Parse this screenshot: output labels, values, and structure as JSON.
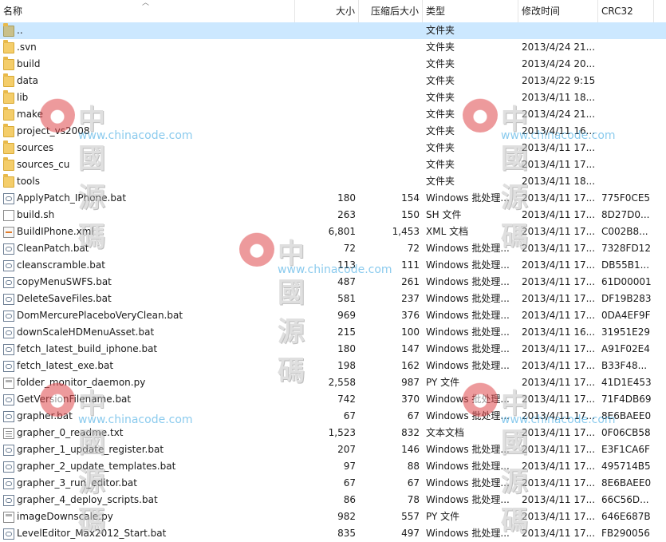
{
  "columns": {
    "name": "名称",
    "size": "大小",
    "compressed": "压缩后大小",
    "type": "类型",
    "modified": "修改时间",
    "crc": "CRC32"
  },
  "files": [
    {
      "name": "..",
      "size": "",
      "compressed": "",
      "type": "文件夹",
      "modified": "",
      "crc": "",
      "icon": "folder-up-icon",
      "selected": true
    },
    {
      "name": ".svn",
      "size": "",
      "compressed": "",
      "type": "文件夹",
      "modified": "2013/4/24 21...",
      "crc": "",
      "icon": "folder-icon"
    },
    {
      "name": "build",
      "size": "",
      "compressed": "",
      "type": "文件夹",
      "modified": "2013/4/24 20...",
      "crc": "",
      "icon": "folder-icon"
    },
    {
      "name": "data",
      "size": "",
      "compressed": "",
      "type": "文件夹",
      "modified": "2013/4/22 9:15",
      "crc": "",
      "icon": "folder-icon"
    },
    {
      "name": "lib",
      "size": "",
      "compressed": "",
      "type": "文件夹",
      "modified": "2013/4/11 18...",
      "crc": "",
      "icon": "folder-icon"
    },
    {
      "name": "make",
      "size": "",
      "compressed": "",
      "type": "文件夹",
      "modified": "2013/4/24 21...",
      "crc": "",
      "icon": "folder-icon"
    },
    {
      "name": "project_vs2008",
      "size": "",
      "compressed": "",
      "type": "文件夹",
      "modified": "2013/4/11 16...",
      "crc": "",
      "icon": "folder-icon"
    },
    {
      "name": "sources",
      "size": "",
      "compressed": "",
      "type": "文件夹",
      "modified": "2013/4/11 17...",
      "crc": "",
      "icon": "folder-icon"
    },
    {
      "name": "sources_cu",
      "size": "",
      "compressed": "",
      "type": "文件夹",
      "modified": "2013/4/11 17...",
      "crc": "",
      "icon": "folder-icon"
    },
    {
      "name": "tools",
      "size": "",
      "compressed": "",
      "type": "文件夹",
      "modified": "2013/4/11 18...",
      "crc": "",
      "icon": "folder-icon"
    },
    {
      "name": "ApplyPatch_IPhone.bat",
      "size": "180",
      "compressed": "154",
      "type": "Windows 批处理...",
      "modified": "2013/4/11 17...",
      "crc": "775F0CE5",
      "icon": "batch-file-icon"
    },
    {
      "name": "build.sh",
      "size": "263",
      "compressed": "150",
      "type": "SH 文件",
      "modified": "2013/4/11 17...",
      "crc": "8D27D0...",
      "icon": "document-icon"
    },
    {
      "name": "BuildIPhone.xml",
      "size": "6,801",
      "compressed": "1,453",
      "type": "XML 文档",
      "modified": "2013/4/11 17...",
      "crc": "C002B8...",
      "icon": "xml-file-icon"
    },
    {
      "name": "CleanPatch.bat",
      "size": "72",
      "compressed": "72",
      "type": "Windows 批处理...",
      "modified": "2013/4/11 17...",
      "crc": "7328FD12",
      "icon": "batch-file-icon"
    },
    {
      "name": "cleanscramble.bat",
      "size": "113",
      "compressed": "111",
      "type": "Windows 批处理...",
      "modified": "2013/4/11 17...",
      "crc": "DB55B1...",
      "icon": "batch-file-icon"
    },
    {
      "name": "copyMenuSWFS.bat",
      "size": "487",
      "compressed": "261",
      "type": "Windows 批处理...",
      "modified": "2013/4/11 17...",
      "crc": "61D00001",
      "icon": "batch-file-icon"
    },
    {
      "name": "DeleteSaveFiles.bat",
      "size": "581",
      "compressed": "237",
      "type": "Windows 批处理...",
      "modified": "2013/4/11 17...",
      "crc": "DF19B283",
      "icon": "batch-file-icon"
    },
    {
      "name": "DomMercurePlaceboVeryClean.bat",
      "size": "969",
      "compressed": "376",
      "type": "Windows 批处理...",
      "modified": "2013/4/11 17...",
      "crc": "0DA4EF9F",
      "icon": "batch-file-icon"
    },
    {
      "name": "downScaleHDMenuAsset.bat",
      "size": "215",
      "compressed": "100",
      "type": "Windows 批处理...",
      "modified": "2013/4/11 16...",
      "crc": "31951E29",
      "icon": "batch-file-icon"
    },
    {
      "name": "fetch_latest_build_iphone.bat",
      "size": "180",
      "compressed": "147",
      "type": "Windows 批处理...",
      "modified": "2013/4/11 17...",
      "crc": "A91F02E4",
      "icon": "batch-file-icon"
    },
    {
      "name": "fetch_latest_exe.bat",
      "size": "198",
      "compressed": "162",
      "type": "Windows 批处理...",
      "modified": "2013/4/11 17...",
      "crc": "B33F48...",
      "icon": "batch-file-icon"
    },
    {
      "name": "folder_monitor_daemon.py",
      "size": "2,558",
      "compressed": "987",
      "type": "PY 文件",
      "modified": "2013/4/11 17...",
      "crc": "41D1E453",
      "icon": "python-file-icon"
    },
    {
      "name": "GetVersionFilename.bat",
      "size": "742",
      "compressed": "370",
      "type": "Windows 批处理...",
      "modified": "2013/4/11 17...",
      "crc": "71F4DB69",
      "icon": "batch-file-icon"
    },
    {
      "name": "grapher.bat",
      "size": "67",
      "compressed": "67",
      "type": "Windows 批处理...",
      "modified": "2013/4/11 17...",
      "crc": "8E6BAEE0",
      "icon": "batch-file-icon"
    },
    {
      "name": "grapher_0_readme.txt",
      "size": "1,523",
      "compressed": "832",
      "type": "文本文档",
      "modified": "2013/4/11 17...",
      "crc": "0F06CB58",
      "icon": "text-file-icon"
    },
    {
      "name": "grapher_1_update_register.bat",
      "size": "207",
      "compressed": "146",
      "type": "Windows 批处理...",
      "modified": "2013/4/11 17...",
      "crc": "E3F1CA6F",
      "icon": "batch-file-icon"
    },
    {
      "name": "grapher_2_update_templates.bat",
      "size": "97",
      "compressed": "88",
      "type": "Windows 批处理...",
      "modified": "2013/4/11 17...",
      "crc": "495714B5",
      "icon": "batch-file-icon"
    },
    {
      "name": "grapher_3_run_editor.bat",
      "size": "67",
      "compressed": "67",
      "type": "Windows 批处理...",
      "modified": "2013/4/11 17...",
      "crc": "8E6BAEE0",
      "icon": "batch-file-icon"
    },
    {
      "name": "grapher_4_deploy_scripts.bat",
      "size": "86",
      "compressed": "78",
      "type": "Windows 批处理...",
      "modified": "2013/4/11 17...",
      "crc": "66C56D...",
      "icon": "batch-file-icon"
    },
    {
      "name": "imageDownscale.py",
      "size": "982",
      "compressed": "557",
      "type": "PY 文件",
      "modified": "2013/4/11 17...",
      "crc": "646E687B",
      "icon": "python-file-icon"
    },
    {
      "name": "LevelEditor_Max2012_Start.bat",
      "size": "835",
      "compressed": "497",
      "type": "Windows 批处理...",
      "modified": "2013/4/11 17...",
      "crc": "FB290056",
      "icon": "batch-file-icon"
    }
  ],
  "watermark": {
    "text": "中國源碼",
    "url": "www.chinacode.com"
  },
  "colors": {
    "selected_row": "#cce8ff",
    "header_border": "#e5e5e5",
    "watermark_logo": "#e0484c",
    "watermark_url": "#2ba0e0"
  }
}
